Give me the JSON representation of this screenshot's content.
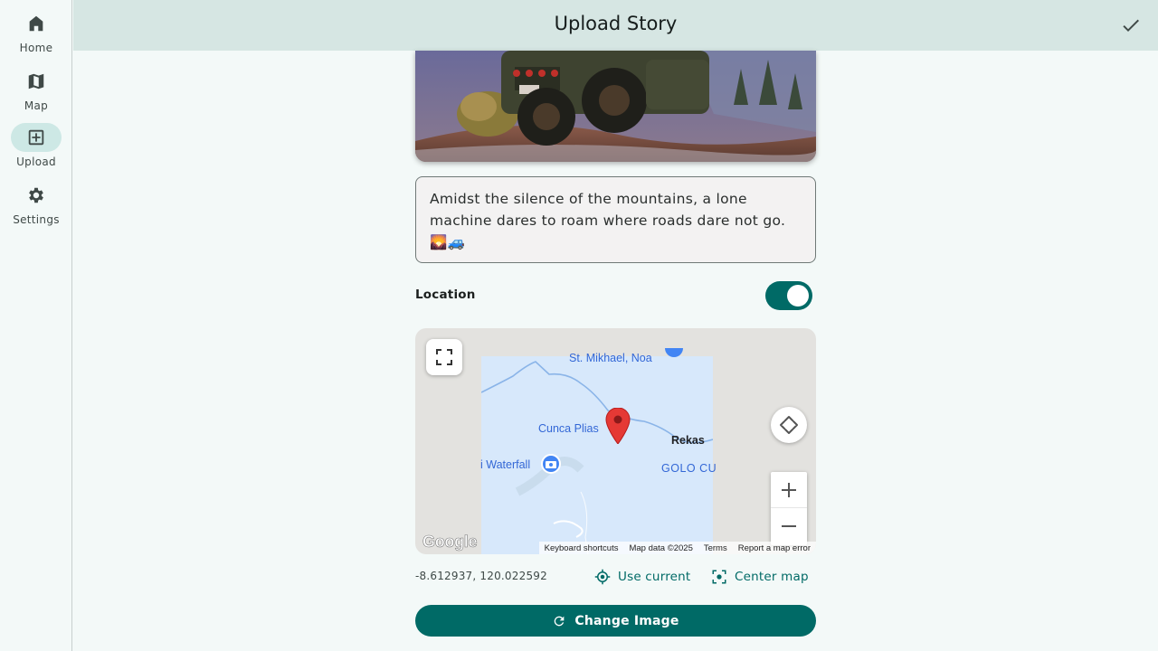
{
  "nav": {
    "items": [
      {
        "label": "Home",
        "icon": "home-icon"
      },
      {
        "label": "Map",
        "icon": "map-icon"
      },
      {
        "label": "Upload",
        "icon": "add-box-icon",
        "active": true
      },
      {
        "label": "Settings",
        "icon": "gear-icon"
      }
    ]
  },
  "header": {
    "title": "Upload Story"
  },
  "story": {
    "caption": "Amidst the silence of the mountains, a lone machine dares to roam where roads dare not go. 🌄🚙"
  },
  "location": {
    "label": "Location",
    "enabled": true,
    "coordinates": "-8.612937, 120.022592"
  },
  "map": {
    "labels": {
      "place1": "St. Mikhael, Noa",
      "place2": "Cunca Plias",
      "place3": "Rekas",
      "place4": "i Waterfall",
      "place5": "GOLO CU"
    },
    "logo": "Google",
    "footer": {
      "shortcuts": "Keyboard shortcuts",
      "data": "Map data ©2025",
      "terms": "Terms",
      "report": "Report a map error"
    }
  },
  "actions": {
    "use_current": "Use current",
    "center_map": "Center map",
    "change_image": "Change Image"
  },
  "colors": {
    "primary": "#006a66",
    "header_bg": "#d6e6e3",
    "active_pill": "#cde8e5",
    "marker": "#e53935"
  }
}
